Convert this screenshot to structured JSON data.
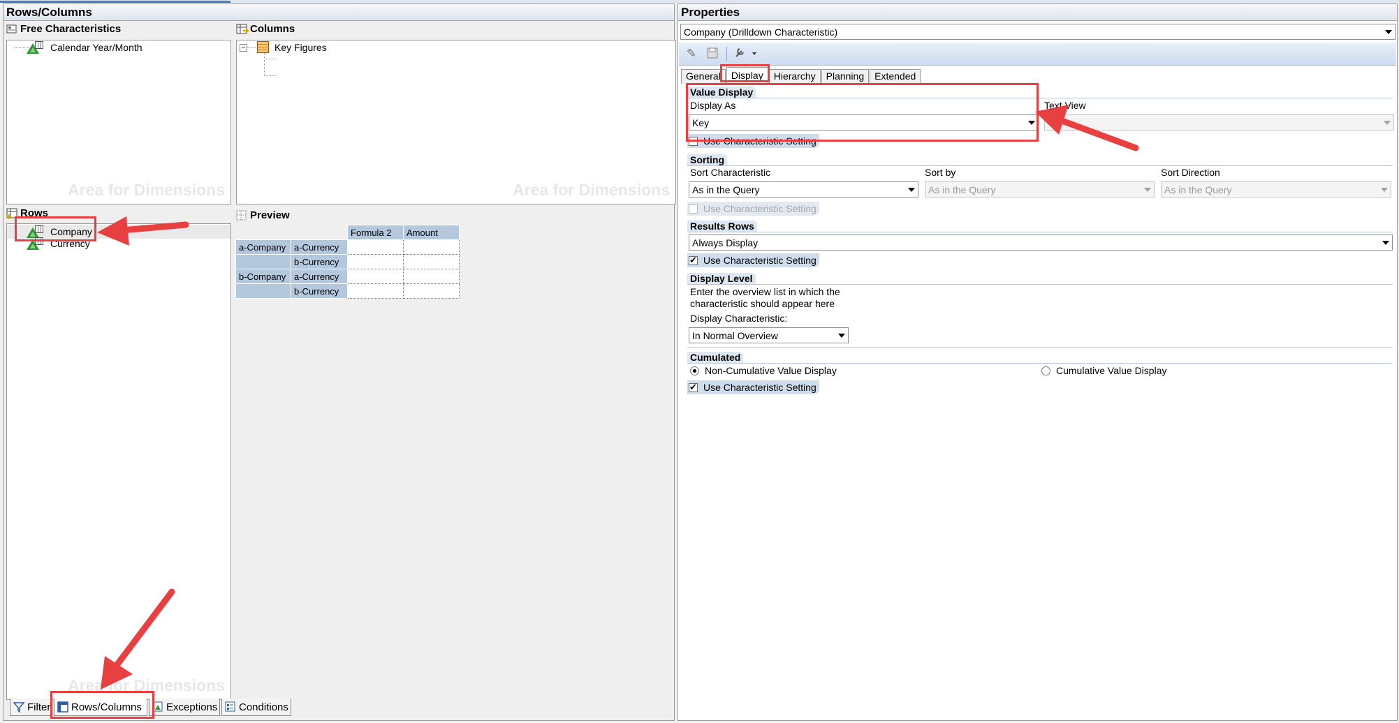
{
  "left": {
    "title": "Rows/Columns",
    "free_chars": {
      "title": "Free Characteristics",
      "items": [
        "Calendar Year/Month"
      ],
      "watermark": "Area for Dimensions"
    },
    "columns": {
      "title": "Columns",
      "items": [
        "Key Figures"
      ],
      "watermark": "Area for Dimensions"
    },
    "rows": {
      "title": "Rows",
      "items": [
        "Company",
        "Currency"
      ],
      "watermark": "Area for Dimensions"
    },
    "preview": {
      "title": "Preview",
      "col_headers": [
        "Formula 2",
        "Amount"
      ],
      "rows": [
        {
          "c1": "a-Company",
          "c2": "a-Currency"
        },
        {
          "c1": "",
          "c2": "b-Currency"
        },
        {
          "c1": "b-Company",
          "c2": "a-Currency"
        },
        {
          "c1": "",
          "c2": "b-Currency"
        }
      ]
    },
    "bottom_tabs": [
      "Filter",
      "Rows/Columns",
      "Exceptions",
      "Conditions"
    ]
  },
  "right": {
    "title": "Properties",
    "object_select": "Company (Drilldown Characteristic)",
    "tabs": [
      "General",
      "Display",
      "Hierarchy",
      "Planning",
      "Extended"
    ],
    "value_display": {
      "title": "Value Display",
      "display_as_label": "Display As",
      "display_as_value": "Key",
      "text_view_label": "Text View",
      "use_char_setting": "Use Characteristic Setting"
    },
    "sorting": {
      "title": "Sorting",
      "sort_char_label": "Sort Characteristic",
      "sort_char_value": "As in the Query",
      "sort_by_label": "Sort by",
      "sort_by_value": "As in the Query",
      "sort_dir_label": "Sort Direction",
      "sort_dir_value": "As in the Query",
      "use_char_setting": "Use Characteristic Setting"
    },
    "results_rows": {
      "title": "Results Rows",
      "value": "Always Display",
      "use_char_setting": "Use Characteristic Setting"
    },
    "display_level": {
      "title": "Display Level",
      "desc_line1": "Enter the overview list in which the",
      "desc_line2": "characteristic should appear here",
      "char_label": "Display Characteristic:",
      "char_value": "In Normal Overview"
    },
    "cumulated": {
      "title": "Cumulated",
      "non_cum": "Non-Cumulative Value Display",
      "cum": "Cumulative Value Display",
      "use_char_setting": "Use Characteristic Setting"
    }
  },
  "colors": {
    "accent_red": "#e84040",
    "header_blue": "#dde6f1",
    "preview_header": "#b3c7dd"
  }
}
